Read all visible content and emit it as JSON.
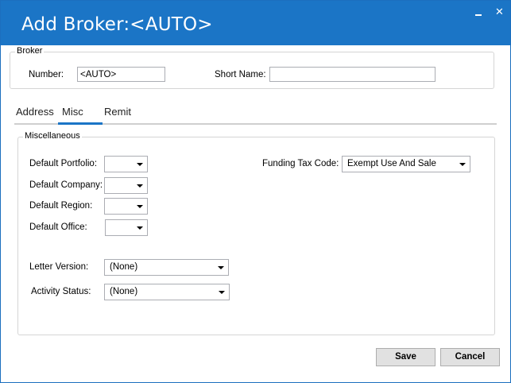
{
  "window": {
    "title": "Add Broker:<AUTO>"
  },
  "broker": {
    "group_label": "Broker",
    "number_label": "Number:",
    "number_value": "<AUTO>",
    "short_name_label": "Short Name:",
    "short_name_value": ""
  },
  "tabs": [
    {
      "label": "Address",
      "active": false
    },
    {
      "label": "Misc",
      "active": true
    },
    {
      "label": "Remit",
      "active": false
    }
  ],
  "misc": {
    "group_label": "Miscellaneous",
    "default_portfolio_label": "Default Portfolio:",
    "default_portfolio_value": "",
    "default_company_label": "Default Company:",
    "default_company_value": "",
    "default_region_label": "Default Region:",
    "default_region_value": "",
    "default_office_label": "Default Office:",
    "default_office_value": "",
    "letter_version_label": "Letter Version:",
    "letter_version_value": "(None)",
    "activity_status_label": "Activity Status:",
    "activity_status_value": "(None)",
    "funding_tax_code_label": "Funding Tax Code:",
    "funding_tax_code_value": "Exempt Use And Sale"
  },
  "buttons": {
    "save": "Save",
    "cancel": "Cancel"
  },
  "colors": {
    "accent": "#1b75c6",
    "title_text": "#ffffff"
  }
}
